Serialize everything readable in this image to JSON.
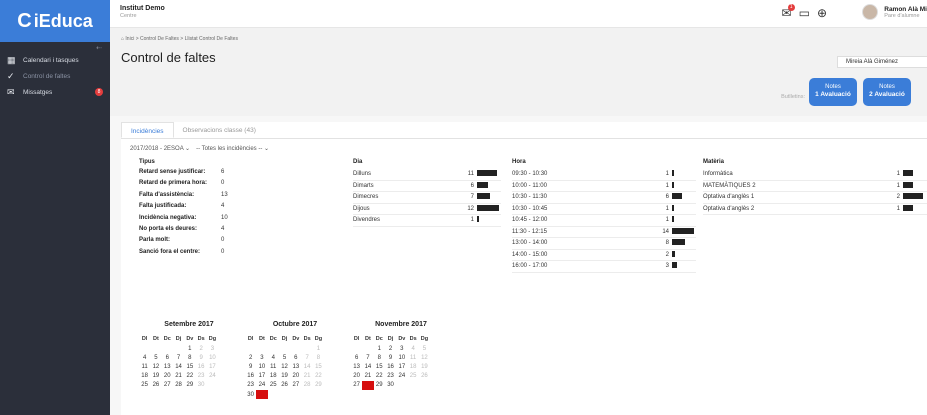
{
  "app": {
    "logo_text": "iEduca",
    "logo_icon": "C"
  },
  "sidebar": {
    "collapse_icon": "⇠",
    "items": [
      {
        "label": "Calendari i tasques",
        "icon": "calendar-icon",
        "glyph": "▦"
      },
      {
        "label": "Control de faltes",
        "icon": "check-circle-icon",
        "glyph": "✓"
      },
      {
        "label": "Missatges",
        "icon": "envelope-icon",
        "glyph": "✉",
        "badge": "8"
      }
    ]
  },
  "header": {
    "institution": "Institut Demo",
    "institution_sub": "Centre",
    "notif_badge": "1",
    "user_name": "Ramon Alà Mi",
    "user_role": "Pare d'alumne"
  },
  "page": {
    "breadcrumb": "⌂ Inici > Control De Faltes > Llistat Control De Faltes",
    "title": "Control de faltes",
    "student": "Mireia Alà Giménez",
    "butlleti_label": "Butlletins:",
    "notes_btn1_top": "Notes",
    "notes_btn1_bottom": "1 Avaluació",
    "notes_btn2_top": "Notes",
    "notes_btn2_bottom": "2 Avaluació"
  },
  "tabs": {
    "incidencies": "Incidències",
    "observacions": "Observacions classe (43)"
  },
  "filters": {
    "year": "2017/2018 - 2ESOA ⌄",
    "type": "-- Totes les incidències -- ⌄"
  },
  "columns": {
    "tipus": "Tipus",
    "dia": "Dia",
    "hora": "Hora",
    "materia": "Matèria"
  },
  "tipus": [
    {
      "label": "Retard sense justificar:",
      "value": "6"
    },
    {
      "label": "Retard de primera hora:",
      "value": "0"
    },
    {
      "label": "Falta d'assistència:",
      "value": "13"
    },
    {
      "label": "Falta justificada:",
      "value": "4"
    },
    {
      "label": "Incidència negativa:",
      "value": "10"
    },
    {
      "label": "No porta els deures:",
      "value": "4"
    },
    {
      "label": "Parla molt:",
      "value": "0"
    },
    {
      "label": "Sanció fora el centre:",
      "value": "0"
    }
  ],
  "dies": [
    {
      "label": "Dilluns",
      "value": 11
    },
    {
      "label": "Dimarts",
      "value": 6
    },
    {
      "label": "Dimecres",
      "value": 7
    },
    {
      "label": "Dijous",
      "value": 12
    },
    {
      "label": "Divendres",
      "value": 1
    }
  ],
  "hores": [
    {
      "label": "09:30 - 10:30",
      "value": 1
    },
    {
      "label": "10:00 - 11:00",
      "value": 1
    },
    {
      "label": "10:30 - 11:30",
      "value": 6
    },
    {
      "label": "10:30 - 10:45",
      "value": 1
    },
    {
      "label": "10:45 - 12:00",
      "value": 1
    },
    {
      "label": "11:30 - 12:15",
      "value": 14
    },
    {
      "label": "13:00 - 14:00",
      "value": 8
    },
    {
      "label": "14:00 - 15:00",
      "value": 2
    },
    {
      "label": "16:00 - 17:00",
      "value": 3
    }
  ],
  "materies": [
    {
      "label": "Informàtica",
      "value": 1
    },
    {
      "label": "MATEMÀTIQUES 2",
      "value": 1
    },
    {
      "label": "Optativa d'anglès 1",
      "value": 2
    },
    {
      "label": "Optativa d'anglès 2",
      "value": 1
    }
  ],
  "calendar": {
    "weekdays": [
      "Dl",
      "Dt",
      "Dc",
      "Dj",
      "Dv",
      "Ds",
      "Dg"
    ],
    "months": [
      {
        "name": "Setembre 2017",
        "offset": 4,
        "days": 30,
        "highlight": []
      },
      {
        "name": "Octubre 2017",
        "offset": 6,
        "days": 31,
        "highlight": [
          31
        ]
      },
      {
        "name": "Novembre 2017",
        "offset": 2,
        "days": 30,
        "highlight": [
          28
        ]
      }
    ]
  },
  "colors": {
    "accent": "#3b7dd8",
    "sidebar": "#2b2f3a",
    "highlight": "#d60f0f"
  }
}
